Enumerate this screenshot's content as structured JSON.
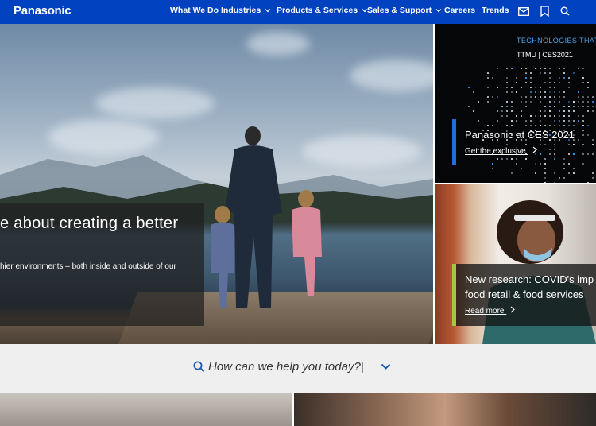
{
  "nav": {
    "logo": "Panasonic",
    "items": [
      {
        "label": "What We Do",
        "dropdown": false
      },
      {
        "label": "Industries",
        "dropdown": true
      },
      {
        "label": "Products & Services",
        "dropdown": true
      },
      {
        "label": "Sales & Support",
        "dropdown": true
      },
      {
        "label": "Careers",
        "dropdown": false
      },
      {
        "label": "Trends",
        "dropdown": false
      }
    ],
    "icons": [
      "mail-icon",
      "bookmark-icon",
      "search-icon"
    ]
  },
  "hero": {
    "title": "e about creating a better",
    "subtitle": "hier environments – both inside and outside of our"
  },
  "cards": [
    {
      "overlay_top": "TECHNOLOGIES THAT",
      "overlay_tag": "TTMU | CES2021",
      "title": "Panasonic at CES 2021",
      "link": "Get the exclusive",
      "accent": "#1e6fd9"
    },
    {
      "title_line1": "New research: COVID's imp",
      "title_line2": "food retail & food services",
      "link": "Read more",
      "accent": "#a6c63b"
    }
  ],
  "search": {
    "placeholder": "How can we help you today?|"
  },
  "colors": {
    "brand": "#0041c0",
    "search_accent": "#1e5bb3"
  }
}
